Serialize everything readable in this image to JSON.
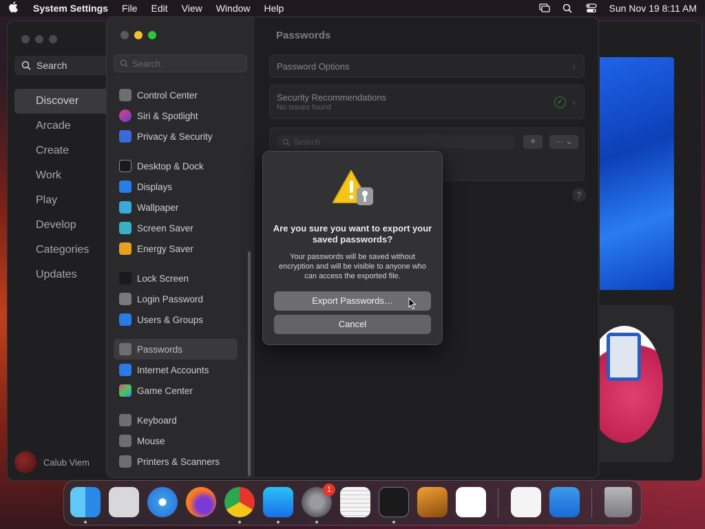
{
  "menubar": {
    "app_name": "System Settings",
    "menus": [
      "File",
      "Edit",
      "View",
      "Window",
      "Help"
    ],
    "datetime": "Sun Nov 19  8:11 AM"
  },
  "appstore": {
    "search_label": "Search",
    "nav": [
      "Discover",
      "Arcade",
      "Create",
      "Work",
      "Play",
      "Develop",
      "Categories",
      "Updates"
    ],
    "user_name": "Calub Viem"
  },
  "settings": {
    "search_placeholder": "Search",
    "sidebar": {
      "group1": [
        "Control Center",
        "Siri & Spotlight",
        "Privacy & Security"
      ],
      "group2": [
        "Desktop & Dock",
        "Displays",
        "Wallpaper",
        "Screen Saver",
        "Energy Saver"
      ],
      "group3": [
        "Lock Screen",
        "Login Password",
        "Users & Groups"
      ],
      "group4": [
        "Passwords",
        "Internet Accounts",
        "Game Center"
      ],
      "group5": [
        "Keyboard",
        "Mouse",
        "Printers & Scanners"
      ]
    },
    "title": "Passwords",
    "password_options": "Password Options",
    "security_title": "Security Recommendations",
    "security_sub": "No issues found",
    "pw_search_placeholder": "Search",
    "add_label": "+",
    "more_label": "··· ⌄",
    "help_label": "?"
  },
  "dialog": {
    "title": "Are you sure you want to export your saved passwords?",
    "body": "Your passwords will be saved without encryption and will be visible to anyone who can access the exported file.",
    "export_label": "Export Passwords…",
    "cancel_label": "Cancel"
  },
  "dock": {
    "apps": [
      "finder-icon",
      "launchpad-icon",
      "safari-icon",
      "firefox-icon",
      "chrome-icon",
      "app-store-icon",
      "system-settings-icon",
      "textedit-icon",
      "terminal-icon",
      "garageband-icon",
      "vscode-icon",
      "visual-studio-icon",
      "weather-icon",
      "trash-icon"
    ],
    "system_settings_badge": "1"
  },
  "colors": {
    "accent_red": "#e8352c",
    "traffic_yellow": "#f5bf2f",
    "traffic_green": "#2ac840",
    "check_green": "#2f9a3a"
  }
}
